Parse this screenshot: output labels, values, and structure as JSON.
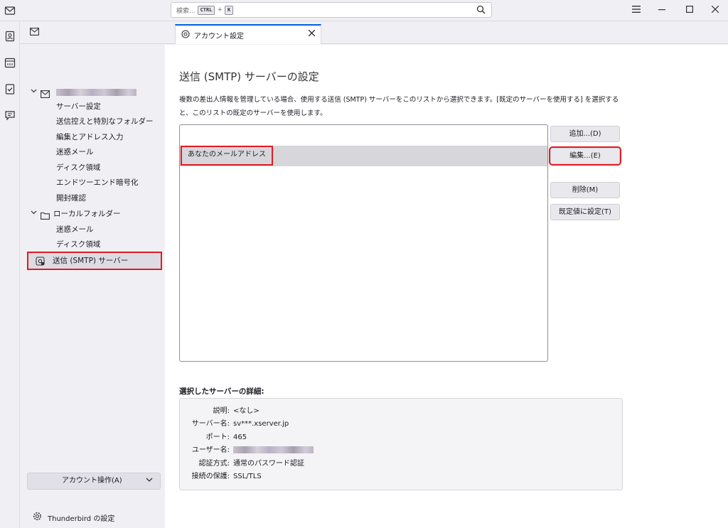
{
  "search": {
    "placeholder": "検索...",
    "key1": "CTRL",
    "plus": "+",
    "key2": "K"
  },
  "tabs": [
    {
      "title": "アカウント設定"
    }
  ],
  "sidebar": {
    "account_tree": [
      {
        "label": "サーバー設定"
      },
      {
        "label": "送信控えと特別なフォルダー"
      },
      {
        "label": "編集とアドレス入力"
      },
      {
        "label": "迷惑メール"
      },
      {
        "label": "ディスク領域"
      },
      {
        "label": "エンドツーエンド暗号化"
      },
      {
        "label": "開封確認"
      }
    ],
    "local_folders": {
      "label": "ローカルフォルダー",
      "items": [
        {
          "label": "迷惑メール"
        },
        {
          "label": "ディスク領域"
        }
      ]
    },
    "smtp_label": "送信 (SMTP) サーバー",
    "account_actions_label": "アカウント操作(A)",
    "settings_label": "Thunderbird の設定"
  },
  "main": {
    "title": "送信 (SMTP) サーバーの設定",
    "description": "複数の差出人情報を管理している場合、使用する送信 (SMTP) サーバーをこのリストから選択できます。[既定のサーバーを使用する] を選択すると、このリストの既定のサーバーを使用します。",
    "server_item": "あなたのメールアドレス",
    "buttons": {
      "add": "追加...(D)",
      "edit": "編集...(E)",
      "remove": "削除(M)",
      "set_default": "既定値に設定(T)"
    },
    "details_heading": "選択したサーバーの詳細:",
    "details": [
      {
        "label": "説明:",
        "value": "<なし>"
      },
      {
        "label": "サーバー名:",
        "value": "sv***.xserver.jp"
      },
      {
        "label": "ポート:",
        "value": "465"
      },
      {
        "label": "ユーザー名:",
        "value": ""
      },
      {
        "label": "認証方式:",
        "value": "通常のパスワード認証"
      },
      {
        "label": "接続の保護:",
        "value": "SSL/TLS"
      }
    ]
  },
  "colors": {
    "accent": "#0060df",
    "highlight_outline": "#e01b24"
  }
}
